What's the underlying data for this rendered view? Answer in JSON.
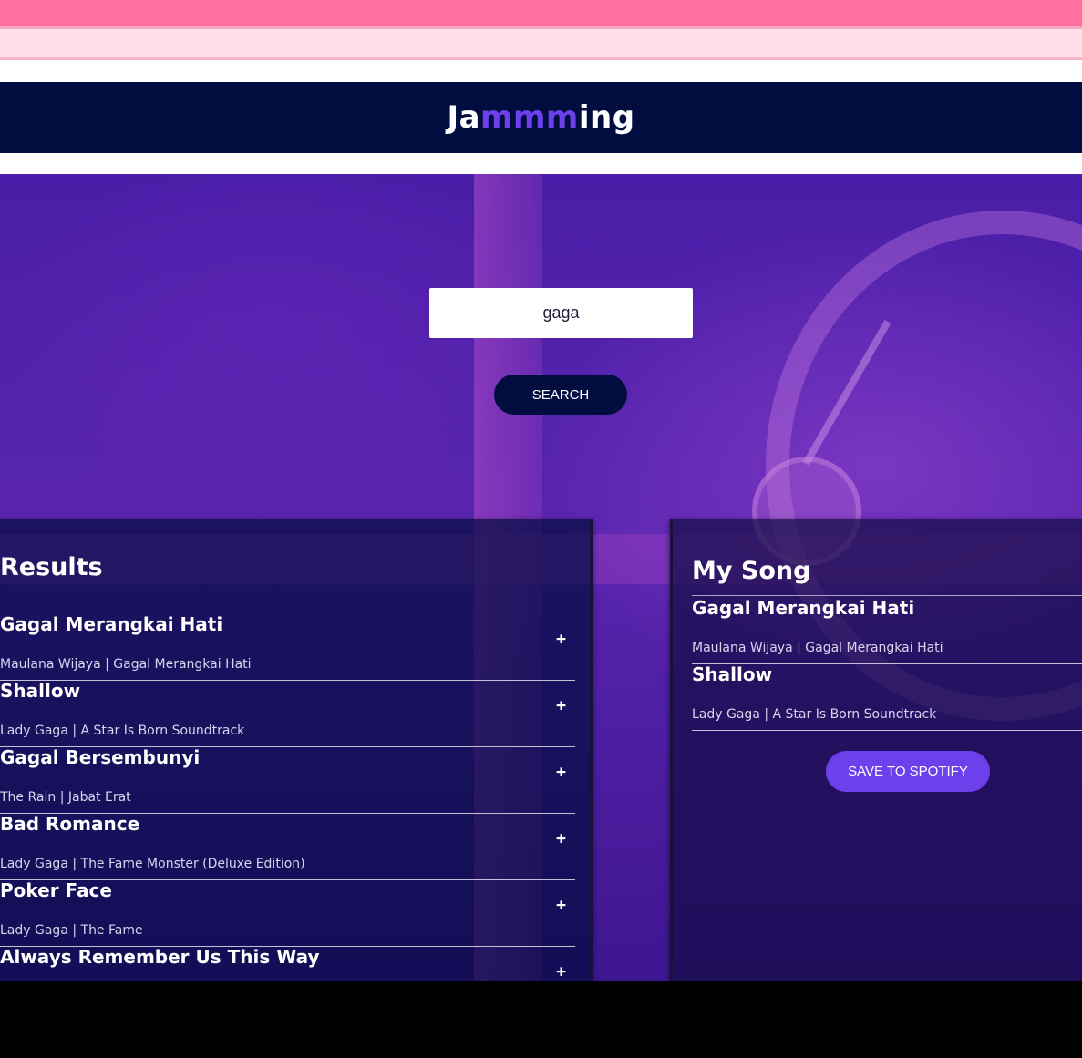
{
  "header": {
    "logo_prefix": "Ja",
    "logo_accent": "mmm",
    "logo_suffix": "ing"
  },
  "search": {
    "value": "gaga",
    "button_label": "SEARCH"
  },
  "results": {
    "title": "Results",
    "add_icon": "+",
    "tracks": [
      {
        "name": "Gagal Merangkai Hati",
        "info": "Maulana Wijaya | Gagal Merangkai Hati"
      },
      {
        "name": "Shallow",
        "info": "Lady Gaga | A Star Is Born Soundtrack"
      },
      {
        "name": "Gagal Bersembunyi",
        "info": "The Rain | Jabat Erat"
      },
      {
        "name": "Bad Romance",
        "info": "Lady Gaga | The Fame Monster (Deluxe Edition)"
      },
      {
        "name": "Poker Face",
        "info": "Lady Gaga | The Fame"
      },
      {
        "name": "Always Remember Us This Way",
        "info": ""
      }
    ]
  },
  "playlist": {
    "title": "My Song",
    "tracks": [
      {
        "name": "Gagal Merangkai Hati",
        "info": "Maulana Wijaya | Gagal Merangkai Hati"
      },
      {
        "name": "Shallow",
        "info": "Lady Gaga | A Star Is Born Soundtrack"
      }
    ],
    "save_label": "SAVE TO SPOTIFY"
  },
  "colors": {
    "header_bg": "#010c3f",
    "accent": "#6c41ec",
    "top_bar": "#ff6f9f"
  }
}
